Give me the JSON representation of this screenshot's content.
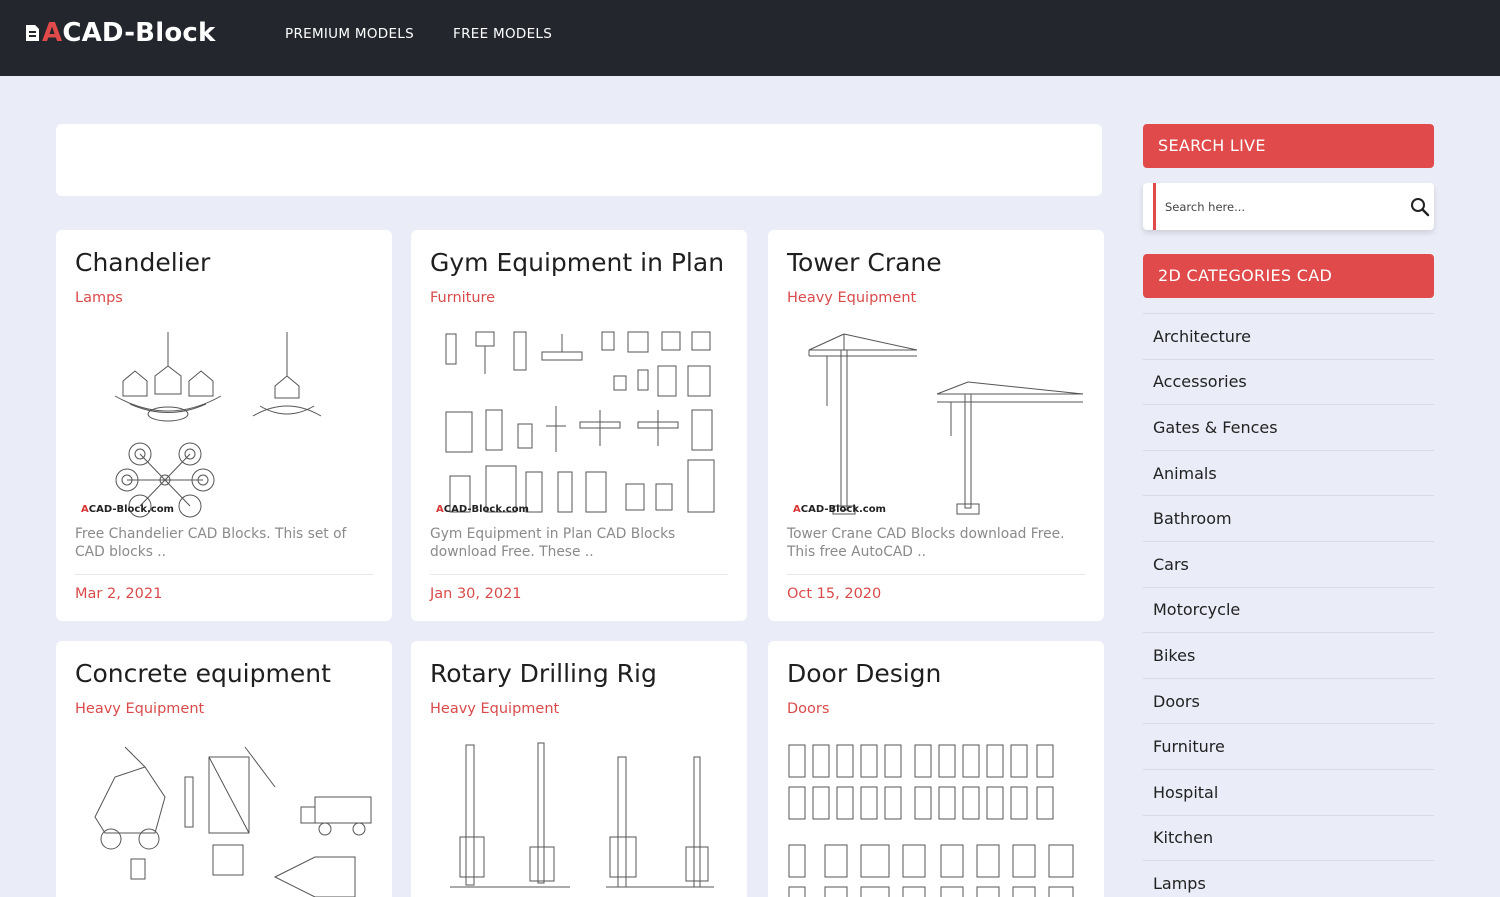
{
  "header": {
    "logo_first": "A",
    "logo_rest": "CAD-Block",
    "nav": [
      {
        "label": "PREMIUM MODELS"
      },
      {
        "label": "FREE MODELS"
      }
    ]
  },
  "posts": [
    {
      "title": "Chandelier",
      "category": "Lamps",
      "description": "Free Chandelier CAD Blocks. This set of CAD blocks ..",
      "date": "Mar 2, 2021",
      "watermark_a": "A",
      "watermark_rest": "CAD-Block.com"
    },
    {
      "title": "Gym Equipment in Plan",
      "category": "Furniture",
      "description": "Gym Equipment in Plan CAD Blocks download Free. These ..",
      "date": "Jan 30, 2021",
      "watermark_a": "A",
      "watermark_rest": "CAD-Block.com"
    },
    {
      "title": "Tower Crane",
      "category": "Heavy Equipment",
      "description": "Tower Crane CAD Blocks download Free. This free AutoCAD ..",
      "date": "Oct 15, 2020",
      "watermark_a": "A",
      "watermark_rest": "CAD-Block.com"
    },
    {
      "title": "Concrete equipment",
      "category": "Heavy Equipment",
      "description": "",
      "date": ""
    },
    {
      "title": "Rotary Drilling Rig",
      "category": "Heavy Equipment",
      "description": "",
      "date": ""
    },
    {
      "title": "Door Design",
      "category": "Doors",
      "description": "",
      "date": ""
    }
  ],
  "sidebar": {
    "search_title": "SEARCH LIVE",
    "search_placeholder": "Search here...",
    "categories_title": "2D CATEGORIES CAD",
    "categories": [
      "Architecture",
      "Accessories",
      "Gates & Fences",
      "Animals",
      "Bathroom",
      "Cars",
      "Motorcycle",
      "Bikes",
      "Doors",
      "Furniture",
      "Hospital",
      "Kitchen",
      "Lamps"
    ]
  },
  "colors": {
    "accent": "#e04a4a",
    "header_bg": "#23262d",
    "page_bg": "#eaecf7"
  },
  "icons": {
    "search": "search-icon",
    "logo": "document-icon"
  }
}
